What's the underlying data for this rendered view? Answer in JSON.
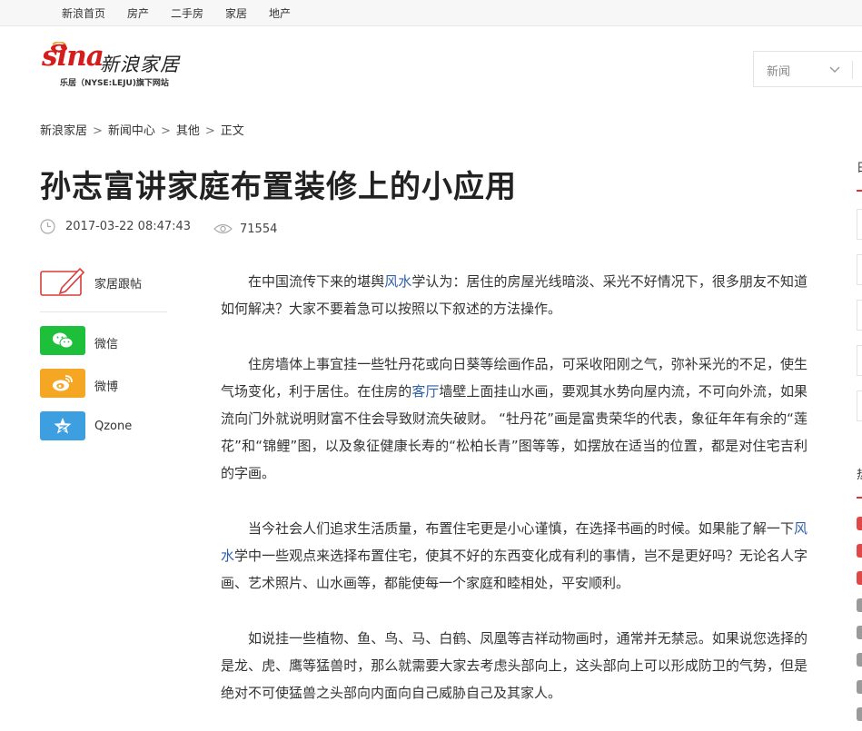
{
  "topnav": {
    "items": [
      {
        "label": "新浪首页"
      },
      {
        "label": "房产"
      },
      {
        "label": "二手房"
      },
      {
        "label": "家居"
      },
      {
        "label": "地产"
      }
    ]
  },
  "logo": {
    "brand": "sina",
    "name": "新浪家居",
    "subtitle": "乐居（NYSE:LEJU)旗下网站"
  },
  "search": {
    "category_selected": "新闻"
  },
  "breadcrumb": {
    "items": [
      "新浪家居",
      "新闻中心",
      "其他",
      "正文"
    ],
    "separator": ">"
  },
  "article": {
    "title": "孙志富讲家庭布置装修上的小应用",
    "date": "2017-03-22 08:47:43",
    "views": "71554",
    "paragraphs": [
      {
        "before": "在中国流传下来的堪舆",
        "link": "风水",
        "after": "学认为：居住的房屋光线暗淡、采光不好情况下，很多朋友不知道如何解决？大家不要着急可以按照以下叙述的方法操作。"
      },
      {
        "before": "住房墙体上事宜挂一些牡丹花或向日葵等绘画作品，可采收阳刚之气，弥补采光的不足，使生气场变化，利于居住。在住房的",
        "link": "客厅",
        "after": "墙壁上面挂山水画，要观其水势向屋内流，不可向外流，如果流向门外就说明财富不住会导致财流失破财。 “牡丹花”画是富贵荣华的代表，象征年年有余的“莲花”和“锦鲤”图，以及象征健康长寿的“松柏长青”图等等，如摆放在适当的位置，都是对住宅吉利的字画。"
      },
      {
        "before": "当今社会人们追求生活质量，布置住宅更是小心谨慎，在选择书画的时候。如果能了解一下",
        "link": "风水",
        "after": "学中一些观点来选择布置住宅，使其不好的东西变化成有利的事情，岂不是更好吗？无论名人字画、艺术照片、山水画等，都能使每一个家庭和睦相处，平安顺利。"
      },
      {
        "before": "如说挂一些植物、鱼、鸟、马、白鹤、凤凰等吉祥动物画时，通常并无禁忌。如果说您选择的是龙、虎、鹰等猛兽时，那么就需要大家去考虑头部向上，这头部向上可以形成防卫的气势，但是绝对不可使猛兽之头部向内面向自己威胁自己及其家人。",
        "link": "",
        "after": ""
      }
    ]
  },
  "share": {
    "comment_label": "家居跟帖",
    "items": [
      {
        "label": "微信",
        "icon": "wechat-icon",
        "color": "#1dbf3b"
      },
      {
        "label": "微博",
        "icon": "weibo-icon",
        "color": "#f5a623"
      },
      {
        "label": "Qzone",
        "icon": "qzone-star-icon",
        "color": "#3d9fe0"
      }
    ]
  },
  "edge": {
    "chars": [
      "日",
      "热"
    ]
  },
  "colors": {
    "accent_red": "#d51d1d",
    "link_blue": "#2f60a8"
  }
}
